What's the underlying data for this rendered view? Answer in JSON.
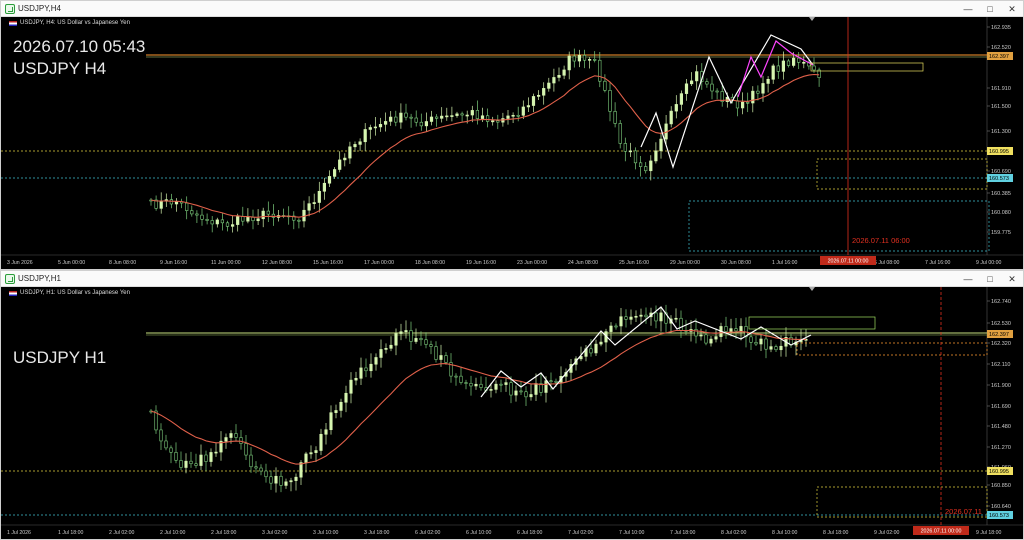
{
  "windows": [
    {
      "id": "h4",
      "title": "USDJPY,H4",
      "info": "USDJPY, H4:  US Dollar vs Japanese Yen",
      "overlay_time": "2026.07.10 05:43",
      "overlay_symbol": "USDJPY H4",
      "y_ticks": [
        "162.935",
        "162.520",
        "162.397",
        "161.910",
        "161.500",
        "161.300",
        "160.995",
        "160.690",
        "160.573",
        "160.385",
        "160.080",
        "159.775"
      ],
      "x_ticks": [
        "3 Jun 2026",
        "5 Jun 00:00",
        "8 Jun 08:00",
        "9 Jun 16:00",
        "11 Jun 00:00",
        "12 Jun 08:00",
        "15 Jun 16:00",
        "17 Jun 00:00",
        "18 Jun 08:00",
        "19 Jun 16:00",
        "23 Jun 00:00",
        "24 Jun 08:00",
        "25 Jun 16:00",
        "29 Jun 00:00",
        "30 Jun 08:00",
        "1 Jul 16:00",
        "3 Jul 00:00",
        "6 Jul 08:00",
        "7 Jul 16:00",
        "9 Jul 00:00"
      ],
      "vline_label": "2026.07.11 06:00",
      "axis_time_label": "2026.07.11 00:00",
      "price_labels": {
        "current": "162.397",
        "level_high": "160.995",
        "level_low": "160.573"
      }
    },
    {
      "id": "h1",
      "title": "USDJPY,H1",
      "info": "USDJPY, H1:  US Dollar vs Japanese Yen",
      "overlay_symbol": "USDJPY H1",
      "y_ticks": [
        "162.740",
        "162.530",
        "162.397",
        "162.320",
        "162.110",
        "161.900",
        "161.690",
        "161.480",
        "161.270",
        "161.060",
        "160.995",
        "160.850",
        "160.640",
        "160.573"
      ],
      "x_ticks": [
        "1 Jul 2026",
        "1 Jul 18:00",
        "2 Jul 02:00",
        "2 Jul 10:00",
        "2 Jul 18:00",
        "3 Jul 02:00",
        "3 Jul 10:00",
        "3 Jul 18:00",
        "6 Jul 02:00",
        "6 Jul 10:00",
        "6 Jul 18:00",
        "7 Jul 02:00",
        "7 Jul 10:00",
        "7 Jul 18:00",
        "8 Jul 02:00",
        "8 Jul 10:00",
        "8 Jul 18:00",
        "9 Jul 02:00",
        "9 Jul 10:00",
        "9 Jul 18:00"
      ],
      "vline_label": "2026.07.11",
      "axis_time_label": "2026.07.11 00:00",
      "price_labels": {
        "current": "162.397",
        "level_high": "160.995",
        "level_low": "160.573"
      }
    }
  ],
  "colors": {
    "background": "#000000",
    "bull_candle": "#d6f5b0",
    "bear_candle": "#7fd07f",
    "ma": "#e0604a",
    "zigzag_h4_white": "#ffffff",
    "zigzag_h4_magenta": "#ff44ff",
    "level_yellow": "#e0d040",
    "level_cyan": "#40c0d0",
    "orange_line": "#ff9a30",
    "vline_red": "#e03020",
    "current_price_bg": "#e0a040"
  },
  "titlebar_icons": [
    "chart-window-icon",
    "minimize-icon",
    "maximize-icon",
    "close-icon"
  ]
}
